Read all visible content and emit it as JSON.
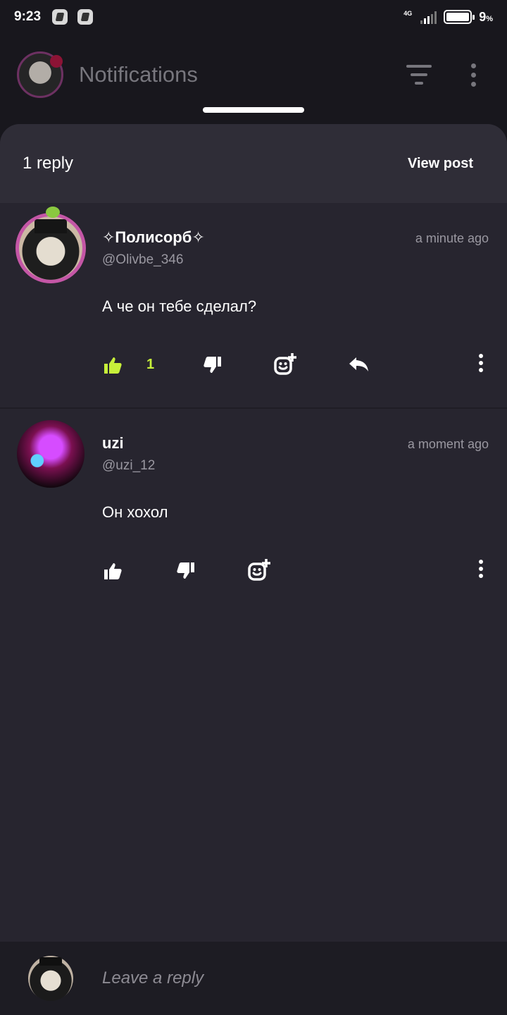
{
  "status_bar": {
    "time": "9:23",
    "network": "4G",
    "battery_level": "9",
    "battery_unit": "%"
  },
  "app_bar": {
    "title": "Notifications",
    "icons": [
      "avatar",
      "filter-icon",
      "more-vertical-icon"
    ]
  },
  "sheet": {
    "reply_count": "1 reply",
    "view_post": "View post"
  },
  "comments": [
    {
      "name": "✧Полисорб✧",
      "handle": "@Olivbe_346",
      "time": "a minute ago",
      "text": "А че он тебе сделал?",
      "likes": "1",
      "liked": true,
      "accent_color": "#c7f03a"
    },
    {
      "name": "uzi",
      "handle": "@uzi_12",
      "time": "a moment ago",
      "text": "Он хохол",
      "likes": "",
      "liked": false
    }
  ],
  "reply_bar": {
    "placeholder": "Leave a reply"
  },
  "colors": {
    "background": "#18171d",
    "sheet": "#27252f",
    "sheet_header": "#2f2d37",
    "accent_like": "#c7f03a",
    "notification_badge": "#b3123e"
  }
}
